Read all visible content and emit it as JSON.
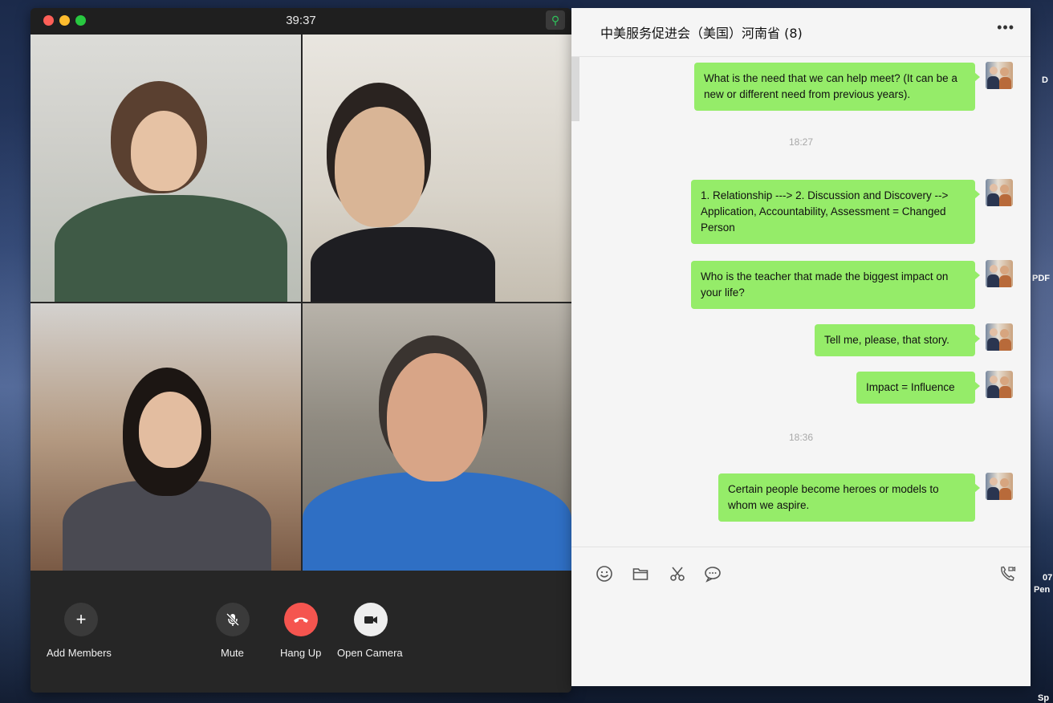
{
  "call": {
    "timer": "39:37",
    "controls": {
      "add_members": "Add Members",
      "mute": "Mute",
      "hang_up": "Hang Up",
      "open_camera": "Open Camera"
    }
  },
  "chat": {
    "title": "中美服务促进会（美国）河南省 (8)",
    "more": "•••",
    "messages": [
      {
        "text": "What is the need that we can help meet? (It can be a new or different need from previous years)."
      },
      {
        "timestamp": "18:27"
      },
      {
        "text": "1. Relationship --->  2. Discussion and Discovery --> Application, Accountability, Assessment = Changed Person"
      },
      {
        "text": "Who is the teacher that made the biggest impact on your life?"
      },
      {
        "text": "Tell me, please, that story."
      },
      {
        "text": "Impact = Influence"
      },
      {
        "timestamp": "18:36"
      },
      {
        "text": "Certain people become heroes or models to whom we aspire."
      }
    ],
    "toolbar_icons": [
      "emoji-icon",
      "folder-icon",
      "scissors-icon",
      "chat-bubble-icon",
      "phone-video-icon"
    ]
  },
  "desktop": {
    "fragments": [
      "D",
      "PDF",
      "07",
      "Pen",
      "Sp"
    ]
  },
  "colors": {
    "bubble": "#95ec69",
    "hang_up": "#f5554f",
    "call_bg": "#262626",
    "chat_bg": "#f5f5f5"
  }
}
